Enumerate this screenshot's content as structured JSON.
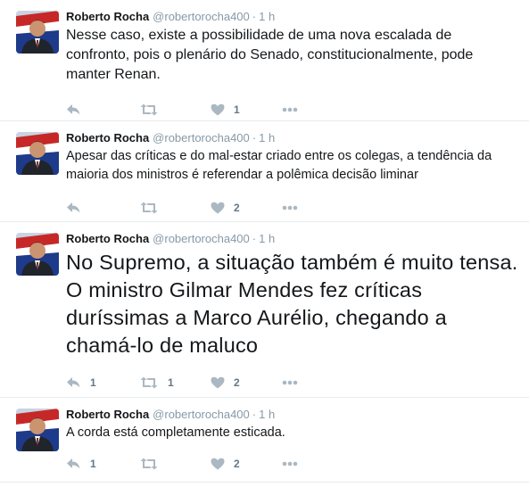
{
  "tweets": [
    {
      "name": "Roberto Rocha",
      "handle": "@robertorocha400",
      "time": "1 h",
      "text": "Nesse caso, existe a possibilidade de uma nova escalada de confronto, pois o plenário do Senado, constitucionalmente, pode manter Renan.",
      "replies": "",
      "retweets": "",
      "likes": "1"
    },
    {
      "name": "Roberto Rocha",
      "handle": "@robertorocha400",
      "time": "1 h",
      "text": "Apesar das críticas e do mal-estar criado entre os colegas, a tendência da maioria dos ministros é referendar a polêmica decisão liminar",
      "replies": "",
      "retweets": "",
      "likes": "2"
    },
    {
      "name": "Roberto Rocha",
      "handle": "@robertorocha400",
      "time": "1 h",
      "text": "No Supremo, a situação também é muito tensa. O ministro Gilmar Mendes fez críticas duríssimas a Marco Aurélio, chegando a chamá-lo de maluco",
      "replies": "1",
      "retweets": "1",
      "likes": "2"
    },
    {
      "name": "Roberto Rocha",
      "handle": "@robertorocha400",
      "time": "1 h",
      "text": "A corda está completamente esticada.",
      "replies": "1",
      "retweets": "",
      "likes": "2"
    }
  ],
  "separator": "·",
  "colors": {
    "text": "#14171a",
    "muted": "#8899a6",
    "icon": "#aab8c2",
    "border": "#e6ecf0"
  }
}
